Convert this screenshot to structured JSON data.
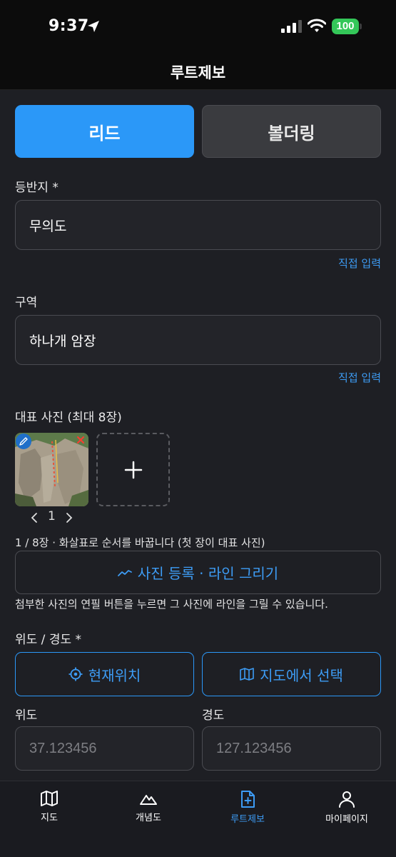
{
  "status": {
    "time": "9:37",
    "battery": "100"
  },
  "nav": {
    "title": "루트제보"
  },
  "segments": {
    "lead": "리드",
    "boulder": "볼더링"
  },
  "crag": {
    "label": "등반지 *",
    "value": "무의도",
    "direct_input": "직접 입력"
  },
  "sector": {
    "label": "구역",
    "value": "하나개 암장",
    "direct_input": "직접 입력"
  },
  "photos": {
    "label": "대표 사진 (최대 8장)",
    "page_number": "1",
    "info": "1 / 8장 · 화살표로 순서를 바꿉니다 (첫 장이 대표 사진)",
    "register_button": "사진 등록 · 라인 그리기",
    "hint": "첨부한 사진의 연필 버튼을 누르면 그 사진에 라인을 그릴 수 있습니다."
  },
  "location": {
    "label": "위도 / 경도 *",
    "current_button": "현재위치",
    "map_button": "지도에서 선택",
    "lat_label": "위도",
    "lng_label": "경도",
    "lat_placeholder": "37.123456",
    "lng_placeholder": "127.123456"
  },
  "tabs": [
    {
      "label": "지도",
      "icon": "map-icon"
    },
    {
      "label": "개념도",
      "icon": "mountain-icon"
    },
    {
      "label": "루트제보",
      "icon": "file-plus-icon",
      "active": true
    },
    {
      "label": "마이페이지",
      "icon": "user-icon"
    }
  ],
  "colors": {
    "accent": "#2b98f8",
    "background": "#1e1f24",
    "battery": "#34c759",
    "delete": "#ff3b30"
  }
}
